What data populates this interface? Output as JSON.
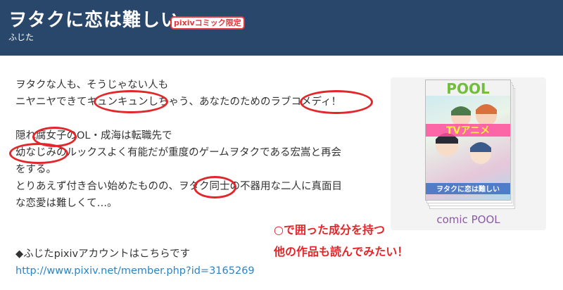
{
  "header": {
    "title": "ヲタクに恋は難しい",
    "badge": "pixivコミック限定",
    "author": "ふじた"
  },
  "description": {
    "lines": [
      "ヲタクな人も、そうじゃない人も",
      "ニヤニヤできてキュンキュンしちゃう、あなたのためのラブコメディ！",
      "",
      "隠れ腐女子のOL・成海は転職先で",
      "幼なじみのルックスよく有能だが重度のゲームヲタクである宏嵩と再会",
      "をする。",
      "とりあえず付き合い始めたものの、ヲタク同士の不器用な二人に真面目",
      "な恋愛は難しくて…。"
    ],
    "account_line": "◆ふじたpixivアカウントはこちらです",
    "account_url": "http://www.pixiv.net/member.php?id=3165269"
  },
  "cover": {
    "caption": "comic POOL",
    "logo": "POOL",
    "band": "TVアニメ",
    "title_text": "ヲタクに恋は難しい"
  },
  "annotation": {
    "line1": "○で囲った成分を持つ",
    "line2": "他の作品も読んでみたい！"
  },
  "colors": {
    "header_bg": "#29476b",
    "circle": "#e3262a",
    "link": "#2a84c6",
    "caption": "#8b5aa5"
  }
}
